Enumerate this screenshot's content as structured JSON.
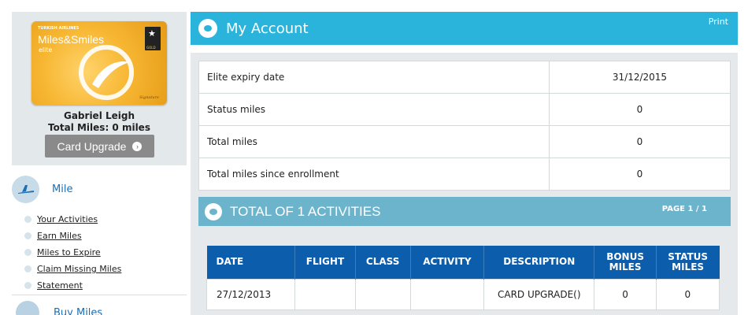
{
  "sidebar": {
    "card": {
      "brand_top": "TURKISH AIRLINES",
      "brand": "Miles&Smiles",
      "tier": "elite",
      "badge_text": "GOLD"
    },
    "holder_name": "Gabriel Leigh",
    "total_miles_text": "Total Miles: 0 miles",
    "upgrade_button": "Card Upgrade",
    "mile_section": {
      "title": "Mile",
      "links": [
        "Your Activities",
        "Earn Miles",
        "Miles to Expire",
        "Claim Missing Miles",
        "Statement"
      ]
    },
    "buy_miles_label": "Buy Miles"
  },
  "header": {
    "title": "My Account",
    "print_label": "Print"
  },
  "summary": {
    "rows": [
      {
        "label": "Elite expiry date",
        "value": "31/12/2015"
      },
      {
        "label": "Status miles",
        "value": "0"
      },
      {
        "label": "Total miles",
        "value": "0"
      },
      {
        "label": "Total miles since enrollment",
        "value": "0"
      }
    ]
  },
  "activities": {
    "title": "TOTAL OF 1 ACTIVITIES",
    "page_indicator": "PAGE 1 / 1",
    "columns": [
      "DATE",
      "FLIGHT",
      "CLASS",
      "ACTIVITY",
      "DESCRIPTION",
      "BONUS MILES",
      "STATUS MILES"
    ],
    "rows": [
      {
        "date": "27/12/2013",
        "flight": "",
        "class": "",
        "activity": "",
        "description": "CARD UPGRADE()",
        "bonus_miles": "0",
        "status_miles": "0"
      }
    ]
  },
  "colors": {
    "header_blue": "#2ab4dc",
    "activities_bar": "#6cb4cc",
    "table_header": "#0c5dac",
    "card_gold": "#f7b733"
  }
}
